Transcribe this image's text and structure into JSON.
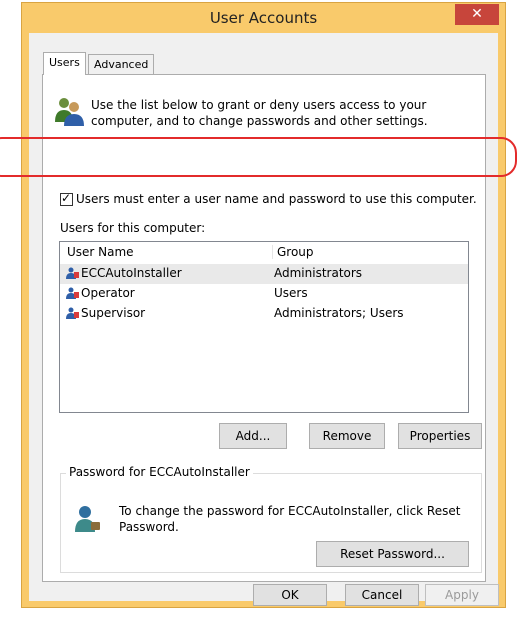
{
  "window": {
    "title": "User Accounts",
    "close_glyph": "✕",
    "frame_color": "#f9ca6b",
    "close_color": "#c7453b"
  },
  "tabs": [
    {
      "label": "Users",
      "active": true
    },
    {
      "label": "Advanced",
      "active": false
    }
  ],
  "intro": {
    "icon": "users-icon",
    "text": "Use the list below to grant or deny users access to your computer, and to change passwords and other settings."
  },
  "require_login": {
    "checked": true,
    "label": "Users must enter a user name and password to use this computer."
  },
  "users_list": {
    "label": "Users for this computer:",
    "columns": [
      "User Name",
      "Group"
    ],
    "rows": [
      {
        "name": "ECCAutoInstaller",
        "group": "Administrators",
        "selected": true
      },
      {
        "name": "Operator",
        "group": "Users",
        "selected": false
      },
      {
        "name": "Supervisor",
        "group": "Administrators; Users",
        "selected": false
      }
    ]
  },
  "list_buttons": {
    "add": "Add...",
    "remove": "Remove",
    "properties": "Properties"
  },
  "password_group": {
    "legend": "Password for ECCAutoInstaller",
    "text": "To change the password for ECCAutoInstaller, click Reset Password.",
    "reset_button": "Reset Password..."
  },
  "dialog_buttons": {
    "ok": "OK",
    "cancel": "Cancel",
    "apply": "Apply"
  },
  "annotation_color": "#e32b2b"
}
